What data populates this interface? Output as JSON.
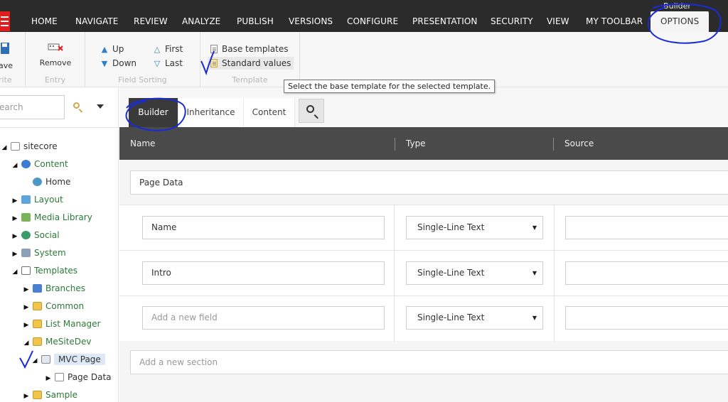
{
  "top_menu": {
    "tabs": [
      "HOME",
      "NAVIGATE",
      "REVIEW",
      "ANALYZE",
      "PUBLISH",
      "VERSIONS",
      "CONFIGURE",
      "PRESENTATION",
      "SECURITY",
      "VIEW",
      "MY TOOLBAR"
    ],
    "context_label": "Builder",
    "active_tab": "OPTIONS"
  },
  "ribbon": {
    "write": {
      "save_label": "ave",
      "group_label": "rite"
    },
    "entry": {
      "remove_label": "Remove",
      "group_label": "Entry"
    },
    "field_sorting": {
      "up": "Up",
      "down": "Down",
      "first": "First",
      "last": "Last",
      "group_label": "Field Sorting"
    },
    "template": {
      "base_templates": "Base templates",
      "standard_values": "Standard values",
      "group_label": "Template"
    }
  },
  "tooltip": "Select the base template for the selected template.",
  "search": {
    "placeholder": "earch"
  },
  "tree": [
    {
      "label": "sitecore",
      "icon": "document-icon"
    },
    {
      "label": "Content",
      "icon": "content-icon"
    },
    {
      "label": "Home",
      "icon": "globe-icon"
    },
    {
      "label": "Layout",
      "icon": "layout-icon"
    },
    {
      "label": "Media Library",
      "icon": "media-icon"
    },
    {
      "label": "Social",
      "icon": "social-icon"
    },
    {
      "label": "System",
      "icon": "system-icon"
    },
    {
      "label": "Templates",
      "icon": "templates-icon"
    },
    {
      "label": "Branches",
      "icon": "branch-icon"
    },
    {
      "label": "Common",
      "icon": "folder-icon"
    },
    {
      "label": "List Manager",
      "icon": "folder-icon"
    },
    {
      "label": "MeSiteDev",
      "icon": "folder-icon"
    },
    {
      "label": "MVC Page",
      "icon": "template-icon"
    },
    {
      "label": "Page Data",
      "icon": "document-icon"
    },
    {
      "label": "Sample",
      "icon": "folder-icon"
    }
  ],
  "editor_tabs": [
    "Builder",
    "Inheritance",
    "Content"
  ],
  "grid": {
    "headers": [
      "Name",
      "Type",
      "Source"
    ],
    "section_name": "Page Data",
    "fields": [
      {
        "name": "Name",
        "type": "Single-Line Text",
        "source": ""
      },
      {
        "name": "Intro",
        "type": "Single-Line Text",
        "source": ""
      }
    ],
    "new_field_placeholder": "Add a new field",
    "new_field_type": "Single-Line Text",
    "new_section_placeholder": "Add a new section"
  },
  "colors": {
    "topbar": "#2b2b2b",
    "accent_red": "#e11d1d",
    "grid_header": "#4a4a4a",
    "annotation_ink": "#1a2bd6"
  }
}
